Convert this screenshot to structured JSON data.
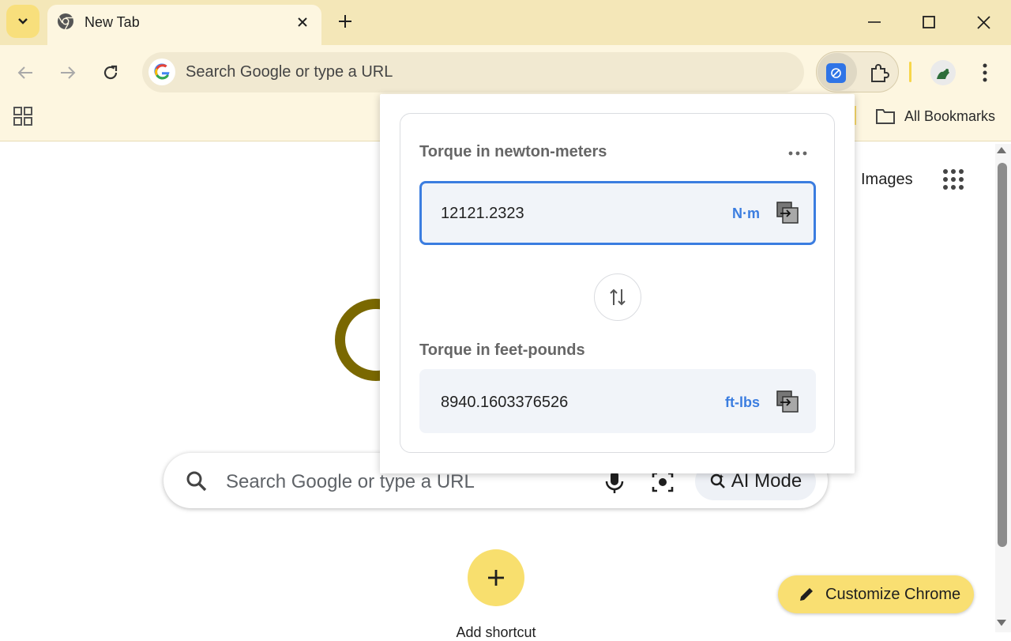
{
  "browser": {
    "tab": {
      "title": "New Tab"
    },
    "omnibox": {
      "placeholder": "Search Google or type a URL"
    },
    "bookmarks": {
      "all_bookmarks_label": "All Bookmarks"
    }
  },
  "page": {
    "images_link": "Images",
    "search": {
      "placeholder": "Search Google or type a URL",
      "ai_mode_label": "AI Mode"
    },
    "add_shortcut_label": "Add shortcut",
    "customize_label": "Customize Chrome"
  },
  "converter": {
    "from_label": "Torque in newton-meters",
    "from_value": "12121.2323",
    "from_unit": "N·m",
    "to_label": "Torque in feet-pounds",
    "to_value": "8940.1603376526",
    "to_unit": "ft-lbs"
  },
  "colors": {
    "tabstrip": "#f4e7b8",
    "toolbar": "#fdf6e0",
    "accent_blue": "#3b7de0",
    "customize_button": "#f9df72"
  },
  "icons": [
    "tab-search-chevron-icon",
    "chrome-icon",
    "close-icon",
    "plus-icon",
    "minimize-icon",
    "maximize-icon",
    "back-icon",
    "forward-icon",
    "reload-icon",
    "google-g-icon",
    "extension-icon",
    "puzzle-icon",
    "avatar-icon",
    "kebab-icon",
    "apps-grid-icon",
    "folder-icon",
    "search-icon",
    "mic-icon",
    "lens-icon",
    "pencil-icon",
    "swap-icon",
    "copy-icon",
    "more-icon"
  ]
}
